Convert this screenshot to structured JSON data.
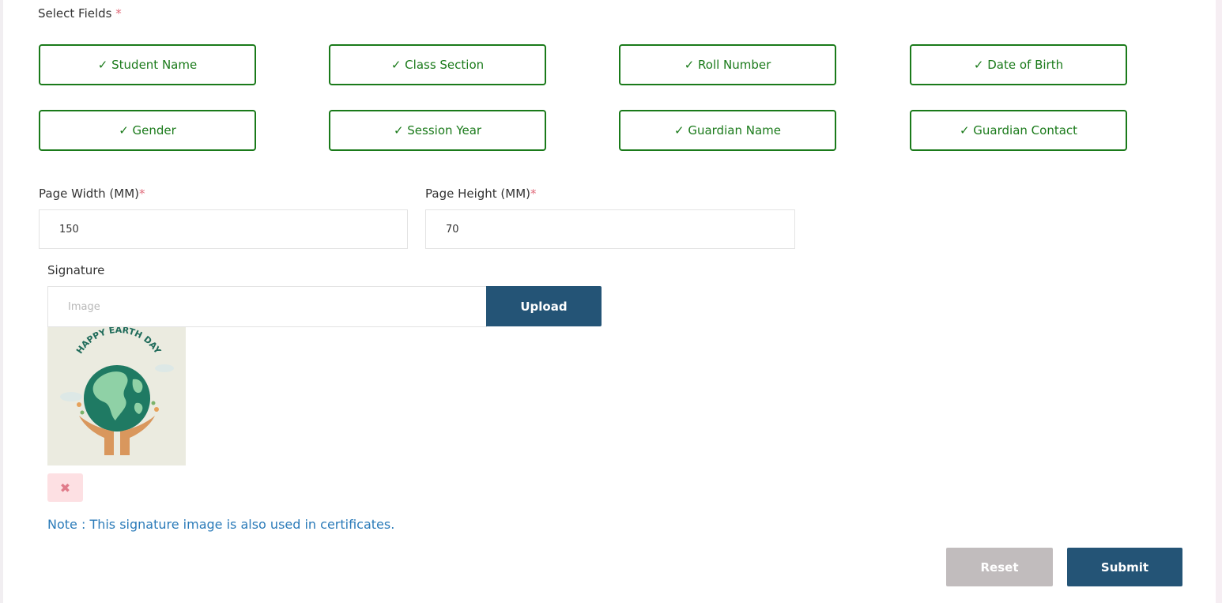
{
  "select_fields": {
    "label": "Select Fields",
    "required_mark": "*",
    "options": [
      "✓ Student Name",
      "✓ Class Section",
      "✓ Roll Number",
      "✓ Date of Birth",
      "✓ Gender",
      "✓ Session Year",
      "✓ Guardian Name",
      "✓ Guardian Contact"
    ]
  },
  "page_width": {
    "label": "Page Width (MM)",
    "required_mark": "*",
    "value": "150"
  },
  "page_height": {
    "label": "Page Height (MM)",
    "required_mark": "*",
    "value": "70"
  },
  "signature": {
    "label": "Signature",
    "placeholder": "Image",
    "upload_label": "Upload",
    "preview_text": "HAPPY EARTH DAY",
    "remove_icon": "close-icon",
    "note": "Note : This signature image is also used in certificates."
  },
  "actions": {
    "reset_label": "Reset",
    "submit_label": "Submit"
  },
  "colors": {
    "chip_border": "#1a7a1a",
    "primary": "#245476",
    "reset_bg": "#c1bcbd",
    "note_text": "#2b7bb9",
    "required": "#e06a7a"
  }
}
